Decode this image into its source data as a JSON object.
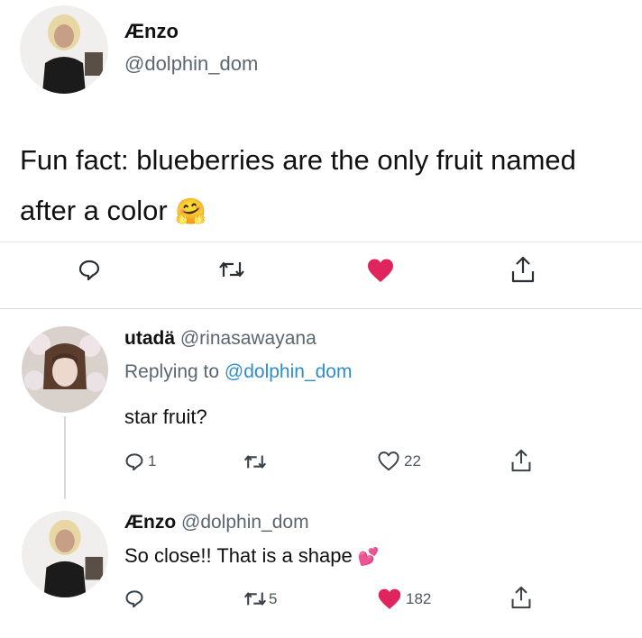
{
  "main_tweet": {
    "display_name": "Ænzo",
    "handle": "@dolphin_dom",
    "text": "Fun fact: blueberries are the only fruit named after a color",
    "emoji": "🤗",
    "actions": {
      "reply_icon": "reply-icon",
      "retweet_icon": "retweet-icon",
      "like_icon": "heart-filled-icon",
      "share_icon": "share-icon",
      "like_color": "#e0245e"
    }
  },
  "reply_1": {
    "display_name": "utadä",
    "handle": "@rinasawayana",
    "replying_prefix": "Replying to",
    "replying_to": "@dolphin_dom",
    "text": "star fruit?",
    "reply_count": "1",
    "retweet_count": "",
    "like_count": "22"
  },
  "reply_2": {
    "display_name": "Ænzo",
    "handle": "@dolphin_dom",
    "text": "So close!! That is a shape",
    "emoji": "💕",
    "reply_count": "",
    "retweet_count": "5",
    "like_count": "182",
    "like_color": "#e0245e"
  }
}
